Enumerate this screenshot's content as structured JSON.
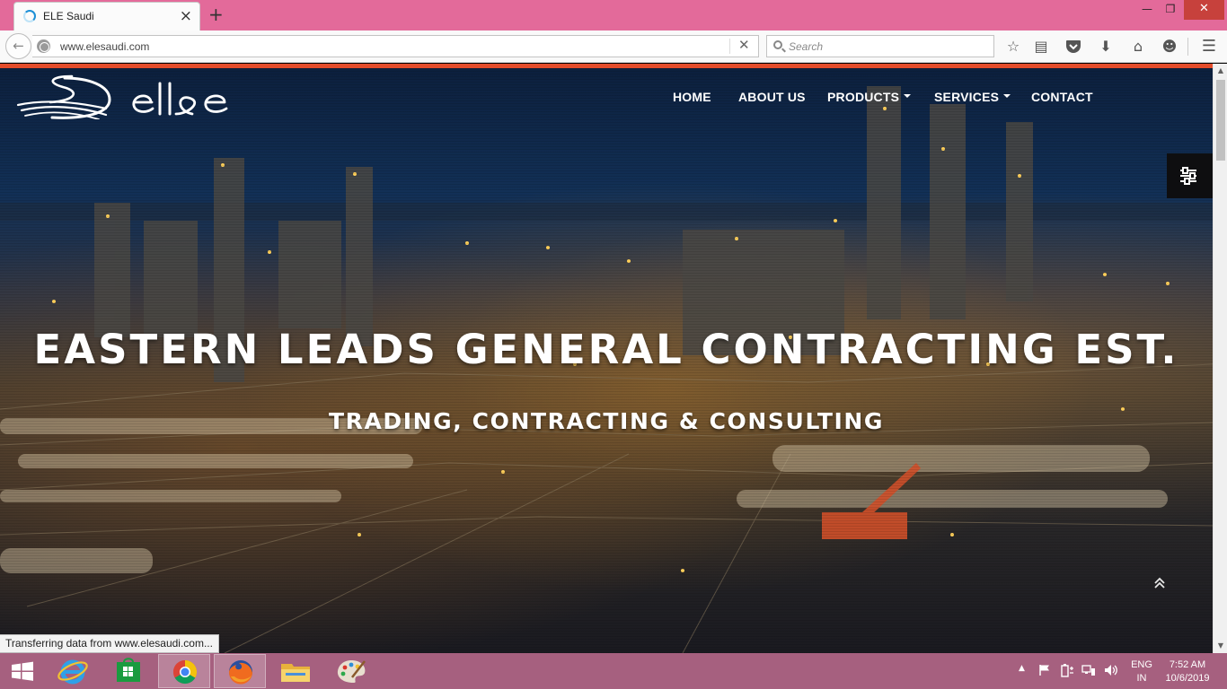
{
  "browser": {
    "tab": {
      "title": "ELE Saudi"
    },
    "url": "www.elesaudi.com",
    "search_placeholder": "Search",
    "status_text": "Transferring data from www.elesaudi.com..."
  },
  "site": {
    "nav": {
      "home": "HOME",
      "about": "ABOUT US",
      "products": "PRODUCTS",
      "services": "SERVICES",
      "contact": "CONTACT"
    },
    "hero": {
      "headline": "EASTERN LEADS GENERAL CONTRACTING EST.",
      "subheadline": "TRADING, CONTRACTING & CONSULTING"
    },
    "colors": {
      "accent_stripe": "#e44c2a",
      "nav_text": "#ffffff",
      "settings_tab_bg": "#0e0e10"
    }
  },
  "taskbar": {
    "apps": [
      "windows-start",
      "internet-explorer",
      "windows-store",
      "google-chrome",
      "firefox",
      "file-explorer",
      "paint"
    ],
    "active_app": "firefox",
    "language": {
      "line1": "ENG",
      "line2": "IN"
    },
    "clock": {
      "time": "7:52 AM",
      "date": "10/6/2019"
    }
  }
}
